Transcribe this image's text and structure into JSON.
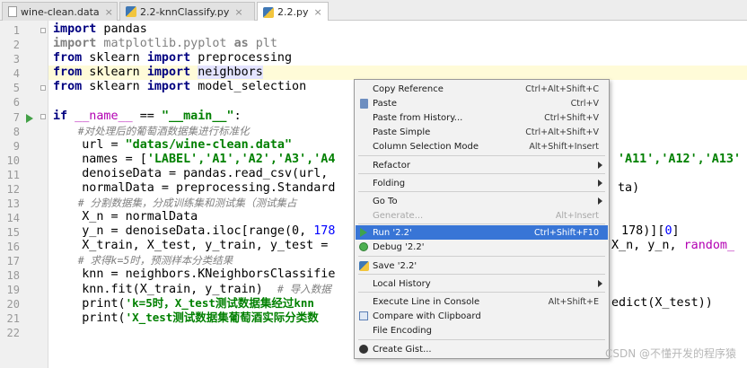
{
  "tabs": [
    {
      "name": "wine-clean.data",
      "close": "×"
    },
    {
      "name": "2.2-knnClassify.py",
      "close": "×"
    },
    {
      "name": "2.2.py",
      "close": "×"
    }
  ],
  "line_numbers": [
    "1",
    "2",
    "3",
    "4",
    "5",
    "6",
    "7",
    "8",
    "9",
    "10",
    "11",
    "12",
    "13",
    "14",
    "15",
    "16",
    "17",
    "18",
    "19",
    "20",
    "21",
    "22"
  ],
  "code": {
    "l1_kw": "import",
    "l1_rest": " pandas",
    "l2_kw": "import",
    "l2_mod": " matplotlib.pyplot ",
    "l2_as": "as",
    "l2_alias": " plt",
    "l3_kw1": "from",
    "l3_mid": " sklearn ",
    "l3_kw2": "import",
    "l3_rest": " preprocessing",
    "l4_kw1": "from",
    "l4_mid": " sklearn ",
    "l4_kw2": "import",
    "l4_sp": " ",
    "l4_rest": "neighbors",
    "l5_kw1": "from",
    "l5_mid": " sklearn ",
    "l5_kw2": "import",
    "l5_rest": " model_selection",
    "l7_kw": "if",
    "l7_name": " __name__",
    "l7_eq": " == ",
    "l7_str": "\"__main__\"",
    "l7_colon": ":",
    "l8_cmt": "    #对处理后的葡萄酒数据集进行标准化",
    "l9_a": "    url = ",
    "l9_str": "\"datas/wine-clean.data\"",
    "l10_a": "    names = [",
    "l10_s": "'LABEL','A1','A2','A3','A4",
    "l10_b": "'A11','A12','A13'",
    "l11_a": "    denoiseData = pandas.read_csv(url,",
    "l12_a": "    normalData = preprocessing.Standard",
    "l12_b": "ta)",
    "l13_cmt": "    # 分割数据集，分成训练集和测试集（测试集占",
    "l14_a": "    X_n = normalData",
    "l15_a": "    y_n = denoiseData.iloc[range(0, ",
    "l15_num": "178",
    "l15_b": " 178)][",
    "l15_num2": "0",
    "l15_c": "]",
    "l16_a": "    X_train, X_test, y_train, y_test =",
    "l16_b": "X_n, y_n, ",
    "l16_mag": "random_",
    "l17_cmt": "    # 求得k=5时，预测样本分类结果",
    "l18_a": "    knn = neighbors.KNeighborsClassifie",
    "l19_a": "    knn.fit(X_train, y_train)  ",
    "l19_cmt": "# 导入数据",
    "l20_a": "    print(",
    "l20_str": "'k=5时，X_test测试数据集经过knn",
    "l20_b": "edict(X_test))",
    "l21_a": "    print(",
    "l21_str": "'X_test测试数据集葡萄酒实际分类数"
  },
  "menu": {
    "items": [
      {
        "label": "Copy Reference",
        "shortcut": "Ctrl+Alt+Shift+C"
      },
      {
        "label": "Paste",
        "shortcut": "Ctrl+V"
      },
      {
        "label": "Paste from History...",
        "shortcut": "Ctrl+Shift+V"
      },
      {
        "label": "Paste Simple",
        "shortcut": "Ctrl+Alt+Shift+V"
      },
      {
        "label": "Column Selection Mode",
        "shortcut": "Alt+Shift+Insert"
      },
      {
        "label": "Refactor",
        "shortcut": ""
      },
      {
        "label": "Folding",
        "shortcut": ""
      },
      {
        "label": "Go To",
        "shortcut": ""
      },
      {
        "label": "Generate...",
        "shortcut": "Alt+Insert"
      },
      {
        "label": "Run '2.2'",
        "shortcut": "Ctrl+Shift+F10"
      },
      {
        "label": "Debug '2.2'",
        "shortcut": ""
      },
      {
        "label": "Save '2.2'",
        "shortcut": ""
      },
      {
        "label": "Local History",
        "shortcut": ""
      },
      {
        "label": "Execute Line in Console",
        "shortcut": "Alt+Shift+E"
      },
      {
        "label": "Compare with Clipboard",
        "shortcut": ""
      },
      {
        "label": "File Encoding",
        "shortcut": ""
      },
      {
        "label": "Create Gist...",
        "shortcut": ""
      }
    ]
  },
  "watermark": "CSDN @不懂开发的程序猿",
  "colors": {
    "selection": "#3875d6",
    "keyword": "#000080",
    "string": "#008000",
    "caret_line": "#fffbd8"
  }
}
